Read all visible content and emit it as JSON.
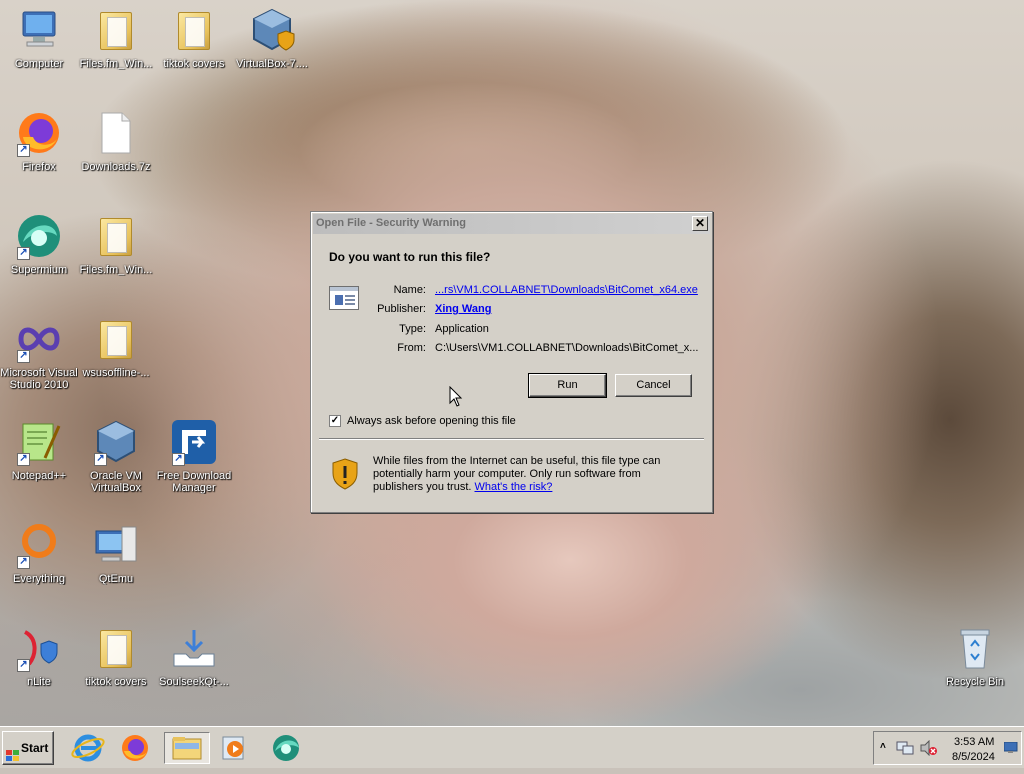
{
  "desktop": {
    "icons": [
      {
        "label": "Computer"
      },
      {
        "label": "Files.fm_Win..."
      },
      {
        "label": "tiktok covers"
      },
      {
        "label": "VirtualBox-7...."
      },
      {
        "label": "Firefox"
      },
      {
        "label": "Downloads.7z"
      },
      {
        "label": "Supermium"
      },
      {
        "label": "Files.fm_Win..."
      },
      {
        "label": "Microsoft Visual Studio 2010"
      },
      {
        "label": "wsusoffline-..."
      },
      {
        "label": "Notepad++"
      },
      {
        "label": "Oracle VM VirtualBox"
      },
      {
        "label": "Free Download Manager"
      },
      {
        "label": "Everything"
      },
      {
        "label": "QtEmu"
      },
      {
        "label": "nLite"
      },
      {
        "label": "tiktok covers"
      },
      {
        "label": "SoulseekQt-..."
      },
      {
        "label": "Recycle Bin"
      }
    ]
  },
  "dialog": {
    "title": "Open File - Security Warning",
    "close_glyph": "✕",
    "question": "Do you want to run this file?",
    "name_key": "Name:",
    "name_value": "...rs\\VM1.COLLABNET\\Downloads\\BitComet_x64.exe",
    "publisher_key": "Publisher:",
    "publisher_value": "Xing Wang",
    "type_key": "Type:",
    "type_value": "Application",
    "from_key": "From:",
    "from_value": "C:\\Users\\VM1.COLLABNET\\Downloads\\BitComet_x...",
    "run_label": "Run",
    "cancel_label": "Cancel",
    "checkbox_label": "Always ask before opening this file",
    "checkbox_checked": true,
    "checkbox_mark": "✓",
    "warning_text": "While files from the Internet can be useful, this file type can potentially harm your computer. Only run software from publishers you trust.",
    "risk_link": "What's the risk?"
  },
  "taskbar": {
    "start_label": "Start",
    "clock_time": "3:53 AM",
    "clock_date": "8/5/2024"
  },
  "colors": {
    "link": "#0000ee",
    "dialog_bg": "#d4d0c8",
    "shield": "#e8a317"
  }
}
